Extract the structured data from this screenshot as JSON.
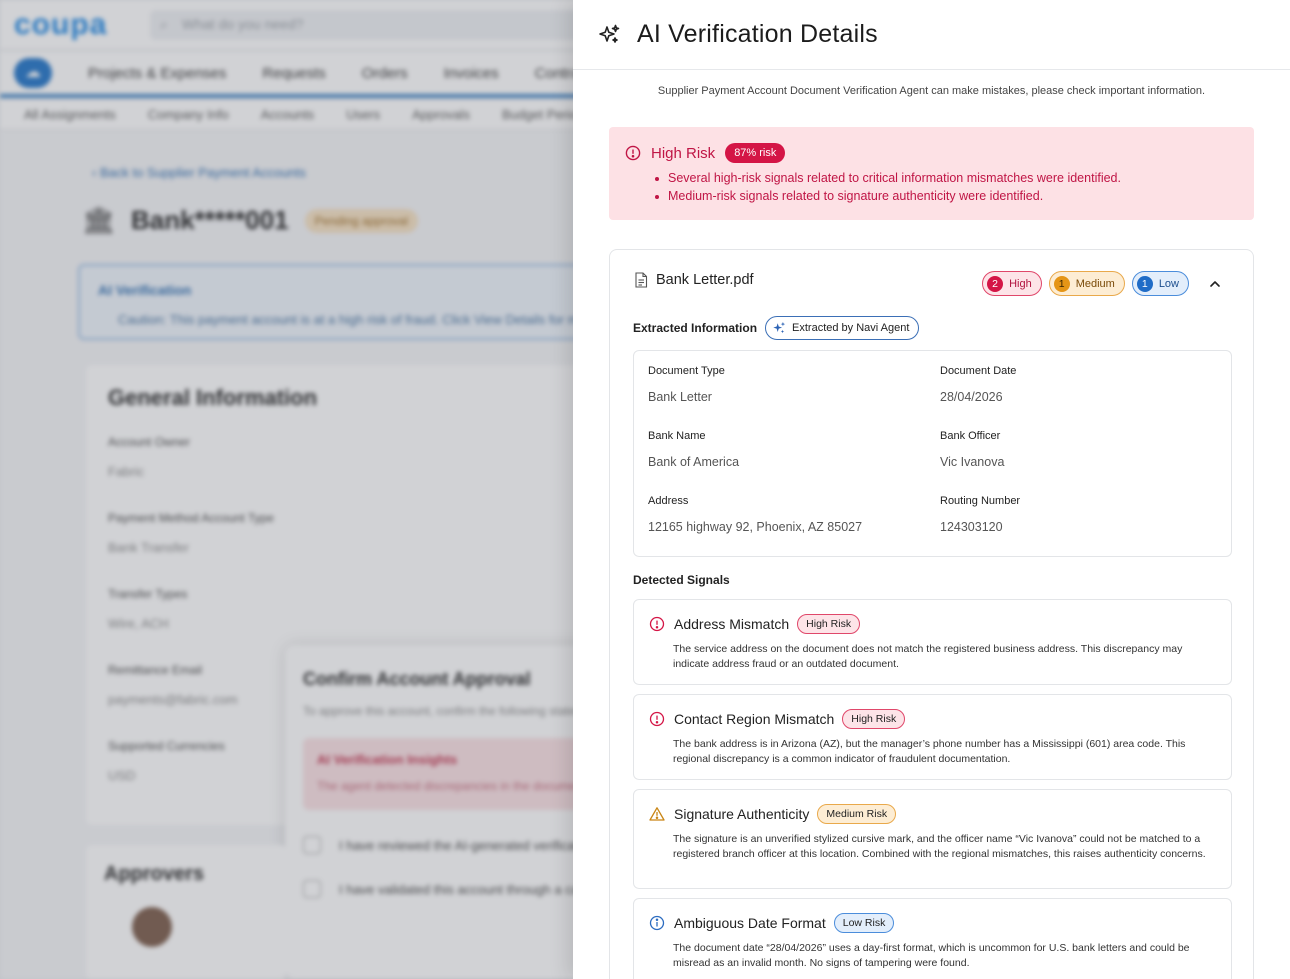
{
  "background": {
    "logo": "coupa",
    "search_placeholder": "What do you need?",
    "nav_tabs": [
      "Projects & Expenses",
      "Requests",
      "Orders",
      "Invoices",
      "Contracts"
    ],
    "subnav_tabs": [
      "All Assignments",
      "Company Info",
      "Accounts",
      "Users",
      "Approvals",
      "Budget Periods"
    ],
    "back_link": "Back to Supplier Payment Accounts",
    "account_title": "Bank*****001",
    "status_badge": "Pending approval",
    "ai_card_title": "AI Verification",
    "ai_card_desc": "Caution: This payment account is at a high risk of fraud. Click View Details for more.",
    "general_title": "General Information",
    "fields": [
      {
        "label": "Account Owner",
        "value": "Fabric"
      },
      {
        "label": "Payment Method Account Type",
        "value": "Bank Transfer"
      },
      {
        "label": "Transfer Types",
        "value": "Wire, ACH"
      },
      {
        "label": "Remittance Email",
        "value": "payments@fabric.com"
      },
      {
        "label": "Supported Currencies",
        "value": "USD"
      }
    ],
    "modal_title": "Confirm Account Approval",
    "modal_desc": "To approve this account, confirm the following statements are true.",
    "modal_warn_title": "AI Verification Insights",
    "modal_warn_desc": "The agent detected discrepancies in the document.",
    "modal_checks": [
      "I have reviewed the AI-generated verification.",
      "I have validated this account through a callback."
    ],
    "approvers_title": "Approvers"
  },
  "panel": {
    "title": "AI Verification Details",
    "disclaimer": "Supplier Payment Account Document Verification Agent can make mistakes, please check important information.",
    "risk": {
      "label": "High Risk",
      "percent_badge": "87% risk",
      "bullets": [
        "Several high-risk signals related to critical information mismatches were identified.",
        "Medium-risk signals related to signature authenticity were identified."
      ]
    },
    "document": {
      "filename": "Bank Letter.pdf",
      "severity": [
        {
          "count": "2",
          "label": "High"
        },
        {
          "count": "1",
          "label": "Medium"
        },
        {
          "count": "1",
          "label": "Low"
        }
      ],
      "extracted_label": "Extracted Information",
      "extracted_by": "Extracted by Navi Agent",
      "fields": [
        {
          "label": "Document Type",
          "value": "Bank Letter"
        },
        {
          "label": "Document Date",
          "value": "28/04/2026"
        },
        {
          "label": "Bank Name",
          "value": "Bank of America"
        },
        {
          "label": "Bank Officer",
          "value": "Vic Ivanova"
        },
        {
          "label": "Address",
          "value": "12165 highway 92, Phoenix, AZ 85027"
        },
        {
          "label": "Routing Number",
          "value": "124303120"
        }
      ],
      "detected_label": "Detected Signals",
      "signals": [
        {
          "title": "Address Mismatch",
          "badge": "High Risk",
          "level": "high",
          "desc": "The service address on the document does not match the registered business address. This discrepancy may indicate address fraud or an outdated document."
        },
        {
          "title": "Contact Region Mismatch",
          "badge": "High Risk",
          "level": "high",
          "desc": "The bank address is in Arizona (AZ), but the manager’s phone number has a Mississippi (601) area code. This regional discrepancy is a common indicator of fraudulent documentation."
        },
        {
          "title": "Signature Authenticity",
          "badge": "Medium Risk",
          "level": "medium",
          "desc": "The signature is an unverified stylized cursive mark, and the officer name “Vic Ivanova” could not be matched to a registered branch officer at this location. Combined with the regional mismatches, this raises authenticity concerns."
        },
        {
          "title": "Ambiguous Date Format",
          "badge": "Low Risk",
          "level": "low",
          "desc": "The document date “28/04/2026” uses a day-first format, which is uncommon for U.S. bank letters and could be misread as an invalid month. No signs of tampering were found."
        }
      ]
    }
  },
  "colors": {
    "high": "#d41546",
    "medium": "#e59516",
    "low": "#1f6cc7",
    "risk_bg": "#fde1e5"
  }
}
